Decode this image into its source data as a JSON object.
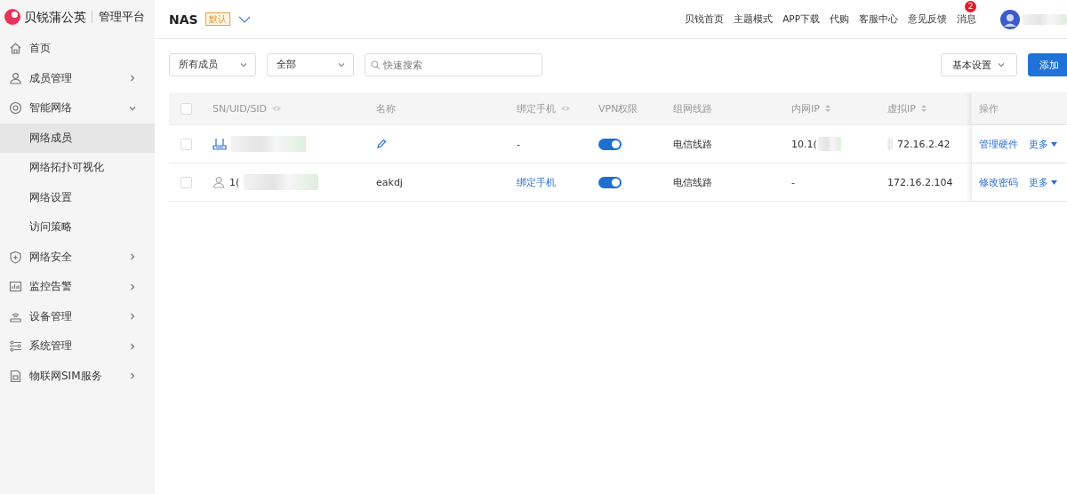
{
  "brand": {
    "name": "贝锐蒲公英",
    "subtitle": "管理平台"
  },
  "network": {
    "name": "NAS",
    "badge": "默认"
  },
  "top_links": [
    "贝锐首页",
    "主题模式",
    "APP下载",
    "代购",
    "客服中心",
    "意见反馈",
    "消息"
  ],
  "notification_count": "2",
  "user": {
    "name_redacted": true
  },
  "sidebar": {
    "items": [
      {
        "label": "首页",
        "kind": "page",
        "selected": false
      },
      {
        "label": "成员管理",
        "kind": "group",
        "expanded": false,
        "selected": false
      },
      {
        "label": "智能网络",
        "kind": "group",
        "expanded": true,
        "selected": false,
        "children": [
          {
            "label": "网络成员",
            "selected": true
          },
          {
            "label": "网络拓扑可视化",
            "selected": false
          },
          {
            "label": "网络设置",
            "selected": false
          },
          {
            "label": "访问策略",
            "selected": false
          }
        ]
      },
      {
        "label": "网络安全",
        "kind": "group",
        "expanded": false,
        "selected": false
      },
      {
        "label": "监控告警",
        "kind": "group",
        "expanded": false,
        "selected": false
      },
      {
        "label": "设备管理",
        "kind": "group",
        "expanded": false,
        "selected": false
      },
      {
        "label": "系统管理",
        "kind": "group",
        "expanded": false,
        "selected": false
      },
      {
        "label": "物联网SIM服务",
        "kind": "group",
        "expanded": false,
        "selected": false
      }
    ]
  },
  "filters": [
    {
      "value": "所有成员"
    },
    {
      "value": "全部"
    }
  ],
  "search": {
    "placeholder": "快速搜索"
  },
  "settings_button": "基本设置",
  "add_button": "添加",
  "table": {
    "all_checked": false,
    "columns": [
      {
        "label": "SN/UID/SID",
        "visibility_toggle": true,
        "sortable": false
      },
      {
        "label": "名称",
        "visibility_toggle": false,
        "sortable": false
      },
      {
        "label": "绑定手机",
        "visibility_toggle": true,
        "sortable": false
      },
      {
        "label": "VPN权限",
        "visibility_toggle": false,
        "sortable": false
      },
      {
        "label": "组网线路",
        "visibility_toggle": false,
        "sortable": false
      },
      {
        "label": "内网IP",
        "visibility_toggle": false,
        "sortable": true
      },
      {
        "label": "虚拟IP",
        "visibility_toggle": false,
        "sortable": true
      },
      {
        "label": "操作",
        "visibility_toggle": false,
        "sortable": false
      }
    ],
    "rows": [
      {
        "kind": "device",
        "checked": false,
        "sn_redacted": true,
        "name_editable": true,
        "phone": "-",
        "phone_link": false,
        "vpn_on": true,
        "line": "电信线路",
        "lan_ip": "10.1(",
        "lan_ip_redacted": true,
        "virtual_ip": "72.16.2.42",
        "virtual_ip_redacted": true,
        "action": "管理硬件",
        "more": "更多"
      },
      {
        "kind": "member",
        "checked": false,
        "sn": "1(",
        "sn_redacted": true,
        "name": "eakdj",
        "name_editable": false,
        "phone": "绑定手机",
        "phone_link": true,
        "vpn_on": true,
        "line": "电信线路",
        "lan_ip": "-",
        "lan_ip_redacted": false,
        "virtual_ip": "172.16.2.104",
        "virtual_ip_redacted": false,
        "action": "修改密码",
        "more": "更多"
      }
    ]
  }
}
